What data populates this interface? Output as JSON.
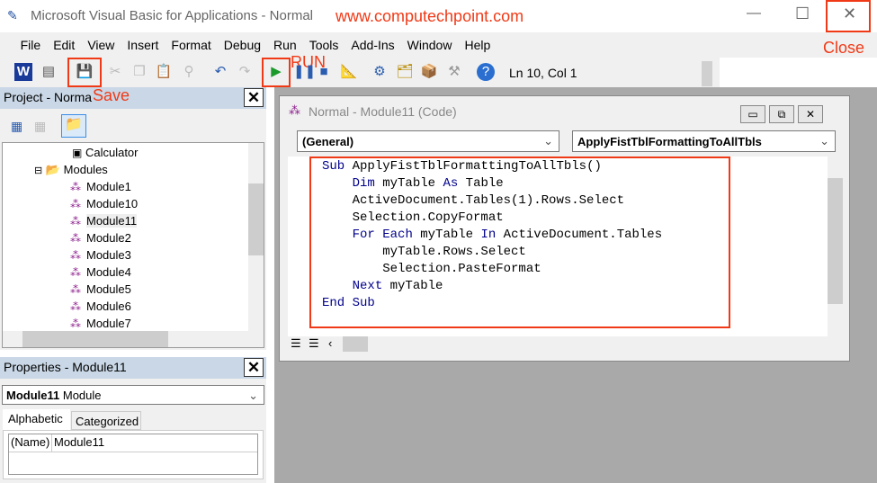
{
  "window": {
    "title": "Microsoft Visual Basic for Applications - Normal",
    "minimize": "—",
    "maximize": "☐",
    "close": "✕"
  },
  "annotations": {
    "site": "www.computechpoint.com",
    "save": "Save",
    "run": "RUN",
    "close": "Close",
    "color": "#f03a17"
  },
  "menu": [
    "File",
    "Edit",
    "View",
    "Insert",
    "Format",
    "Debug",
    "Run",
    "Tools",
    "Add-Ins",
    "Window",
    "Help"
  ],
  "toolbar": {
    "status": "Ln 10, Col 1"
  },
  "project": {
    "title": "Project - Norma",
    "tree": [
      {
        "label": "Calculator",
        "type": "form"
      },
      {
        "label": "Modules",
        "type": "folder"
      },
      {
        "label": "Module1"
      },
      {
        "label": "Module10"
      },
      {
        "label": "Module11",
        "selected": true
      },
      {
        "label": "Module2"
      },
      {
        "label": "Module3"
      },
      {
        "label": "Module4"
      },
      {
        "label": "Module5"
      },
      {
        "label": "Module6"
      },
      {
        "label": "Module7"
      }
    ]
  },
  "properties": {
    "title": "Properties - Module11",
    "object_name": "Module11",
    "object_type": "Module",
    "tabs": [
      "Alphabetic",
      "Categorized"
    ],
    "rows": [
      {
        "name": "(Name)",
        "value": "Module11"
      }
    ]
  },
  "codewindow": {
    "title": "Normal - Module11 (Code)",
    "object_dropdown": "(General)",
    "proc_dropdown": "ApplyFistTblFormattingToAllTbls",
    "lines": [
      [
        {
          "t": "Sub",
          "k": 1
        },
        {
          "t": " ApplyFistTblFormattingToAllTbls()"
        }
      ],
      [
        {
          "t": "    "
        },
        {
          "t": "Dim",
          "k": 1
        },
        {
          "t": " myTable "
        },
        {
          "t": "As",
          "k": 1
        },
        {
          "t": " Table"
        }
      ],
      [
        {
          "t": "    ActiveDocument.Tables(1).Rows.Select"
        }
      ],
      [
        {
          "t": "    Selection.CopyFormat"
        }
      ],
      [
        {
          "t": "    "
        },
        {
          "t": "For",
          "k": 1
        },
        {
          "t": " "
        },
        {
          "t": "Each",
          "k": 1
        },
        {
          "t": " myTable "
        },
        {
          "t": "In",
          "k": 1
        },
        {
          "t": " ActiveDocument.Tables"
        }
      ],
      [
        {
          "t": "        myTable.Rows.Select"
        }
      ],
      [
        {
          "t": "        Selection.PasteFormat"
        }
      ],
      [
        {
          "t": "    "
        },
        {
          "t": "Next",
          "k": 1
        },
        {
          "t": " myTable"
        }
      ],
      [
        {
          "t": "End",
          "k": 1
        },
        {
          "t": " "
        },
        {
          "t": "Sub",
          "k": 1
        }
      ]
    ]
  }
}
